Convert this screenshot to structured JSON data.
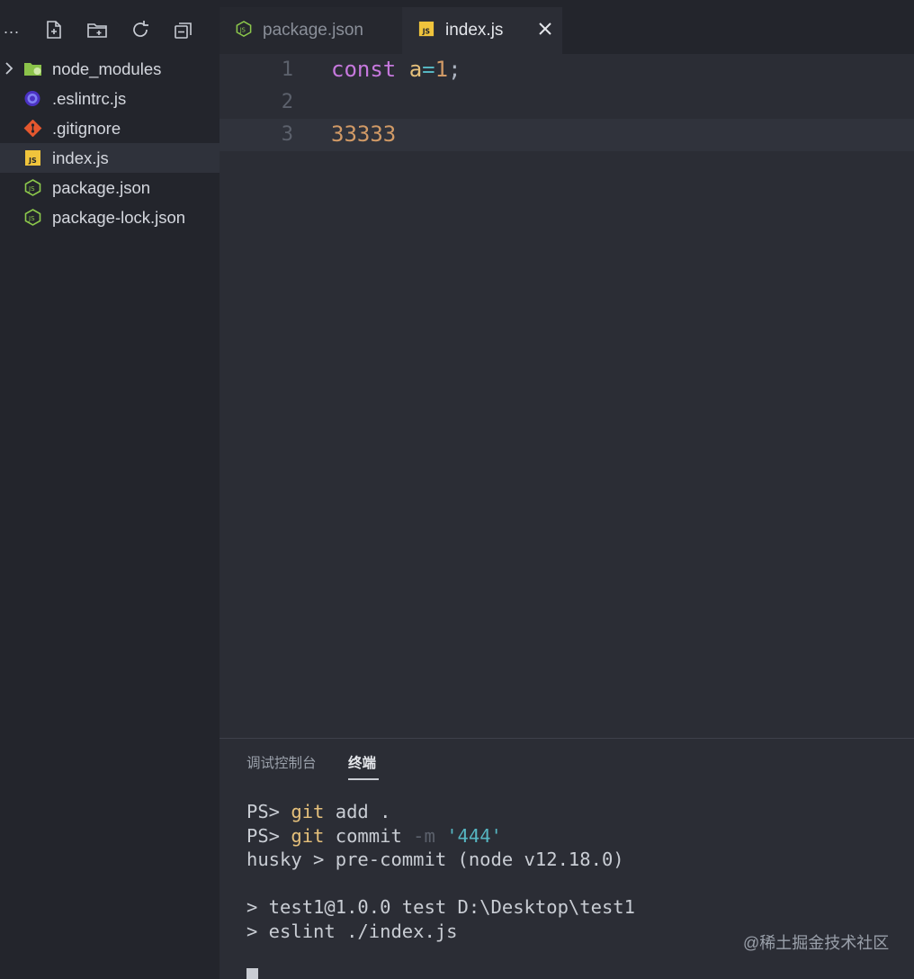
{
  "sidebar": {
    "more_label": "...",
    "toolbar": [
      {
        "icon": "new-file-icon"
      },
      {
        "icon": "new-folder-icon"
      },
      {
        "icon": "refresh-icon"
      },
      {
        "icon": "collapse-all-icon"
      }
    ],
    "files": [
      {
        "name": "node_modules",
        "icon": "folder-icon",
        "expandable": true,
        "active": false
      },
      {
        "name": ".eslintrc.js",
        "icon": "eslint-icon",
        "expandable": false,
        "active": false
      },
      {
        "name": ".gitignore",
        "icon": "git-icon",
        "expandable": false,
        "active": false
      },
      {
        "name": "index.js",
        "icon": "js-icon",
        "expandable": false,
        "active": true
      },
      {
        "name": "package.json",
        "icon": "node-icon",
        "expandable": false,
        "active": false
      },
      {
        "name": "package-lock.json",
        "icon": "node-icon",
        "expandable": false,
        "active": false
      }
    ]
  },
  "tabs": [
    {
      "label": "package.json",
      "icon": "node-icon",
      "active": false
    },
    {
      "label": "index.js",
      "icon": "js-icon",
      "active": true,
      "close_glyph": "×"
    }
  ],
  "editor": {
    "lines": [
      {
        "number": "1",
        "tokens": [
          {
            "t": "const",
            "c": "kw"
          },
          {
            "t": " ",
            "c": "punc"
          },
          {
            "t": "a",
            "c": "var"
          },
          {
            "t": "=",
            "c": "op"
          },
          {
            "t": "1",
            "c": "num"
          },
          {
            "t": ";",
            "c": "punc"
          }
        ]
      },
      {
        "number": "2",
        "tokens": []
      },
      {
        "number": "3",
        "tokens": [
          {
            "t": "33333",
            "c": "num"
          }
        ]
      }
    ],
    "current_line": "3"
  },
  "panel": {
    "tabs": [
      "调试控制台",
      "终端"
    ],
    "active_tab": "终端",
    "terminal_lines": [
      [
        {
          "t": "PS> ",
          "c": ""
        },
        {
          "t": "git",
          "c": "t-git"
        },
        {
          "t": " add .",
          "c": ""
        }
      ],
      [
        {
          "t": "PS> ",
          "c": ""
        },
        {
          "t": "git",
          "c": "t-git"
        },
        {
          "t": " commit ",
          "c": ""
        },
        {
          "t": "-m",
          "c": "t-flag"
        },
        {
          "t": " ",
          "c": ""
        },
        {
          "t": "'444'",
          "c": "t-str"
        }
      ],
      [
        {
          "t": "husky > pre-commit (node v12.18.0)",
          "c": ""
        }
      ],
      [],
      [
        {
          "t": "> test1@1.0.0 test D:\\Desktop\\test1",
          "c": ""
        }
      ],
      [
        {
          "t": "> eslint ./index.js",
          "c": ""
        }
      ]
    ]
  },
  "watermark": "@稀土掘金技术社区",
  "colors": {
    "sidebar_bg": "#23252c",
    "editor_bg": "#2b2d35",
    "keyword": "#c678dd",
    "variable": "#e5c07b",
    "number": "#d19a66",
    "operator": "#56b6c2"
  }
}
